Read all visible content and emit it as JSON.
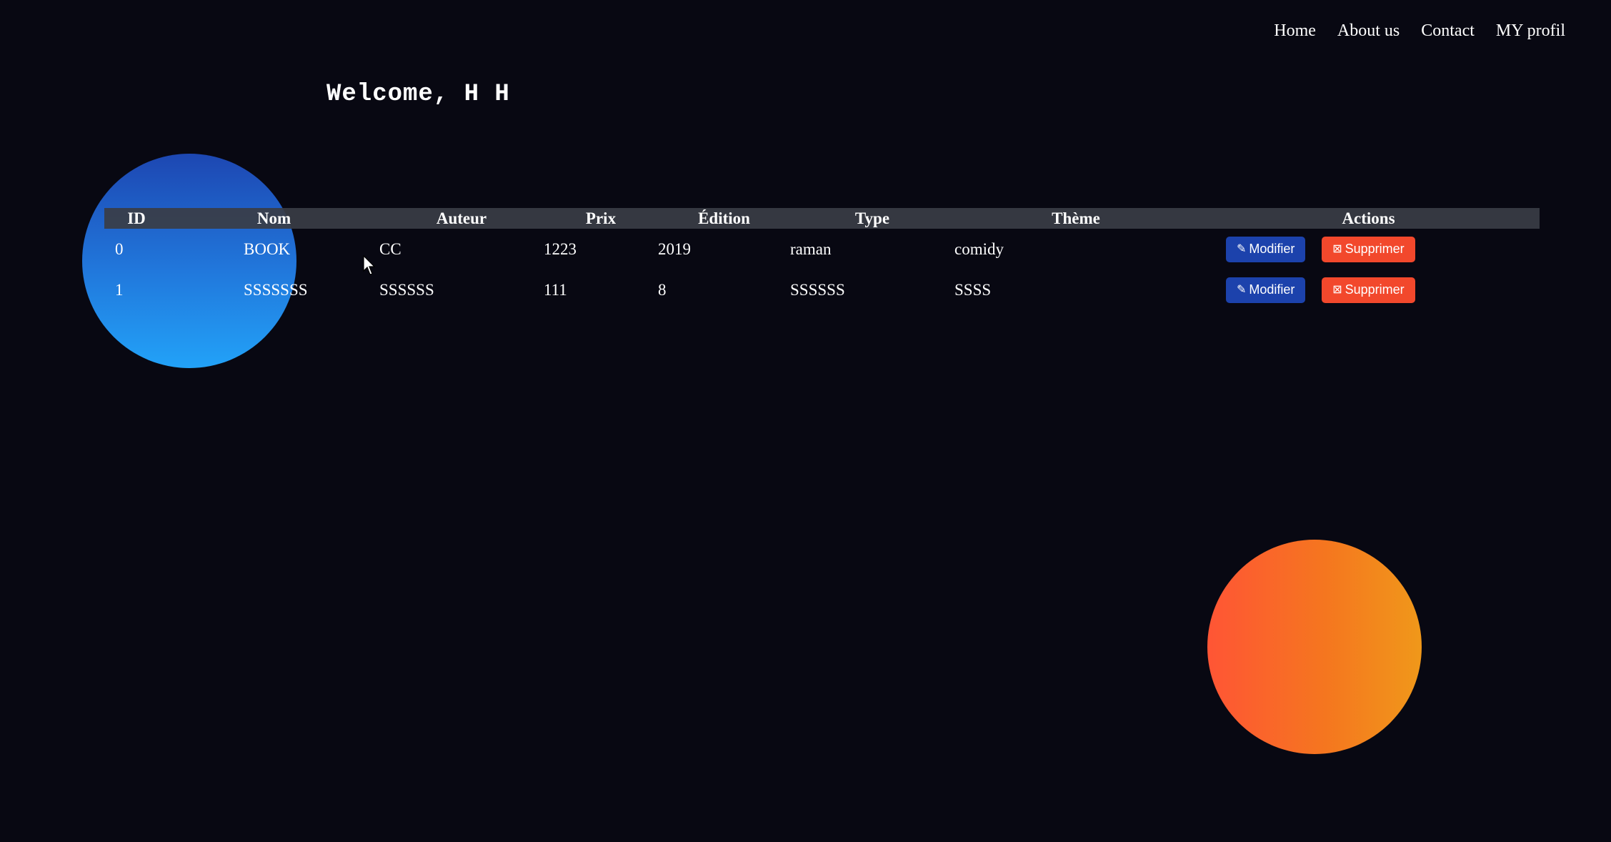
{
  "nav": {
    "items": [
      "Home",
      "About us",
      "Contact",
      "MY profil"
    ]
  },
  "welcome": "Welcome, H H",
  "table": {
    "headers": [
      "ID",
      "Nom",
      "Auteur",
      "Prix",
      "Édition",
      "Type",
      "Thème",
      "Actions"
    ],
    "rows": [
      {
        "id": "0",
        "nom": "BOOK",
        "auteur": "CC",
        "prix": "1223",
        "edition": "2019",
        "type": "raman",
        "theme": "comidy"
      },
      {
        "id": "1",
        "nom": "SSSSSSS",
        "auteur": "SSSSSS",
        "prix": "111",
        "edition": "8",
        "type": "SSSSSS",
        "theme": "SSSS"
      }
    ],
    "actions": {
      "edit_label": "Modifier",
      "delete_label": "Supprimer",
      "edit_icon": "pencil-icon",
      "delete_icon": "x-square-icon"
    }
  },
  "colors": {
    "background": "#080812",
    "header_row": "#3a3d45",
    "edit_button": "#1c42ac",
    "delete_button": "#f2482c",
    "blue_circle_top": "#1d47b2",
    "blue_circle_bottom": "#22a2f8",
    "orange_circle_left": "#ff5535",
    "orange_circle_right": "#f0981a"
  }
}
